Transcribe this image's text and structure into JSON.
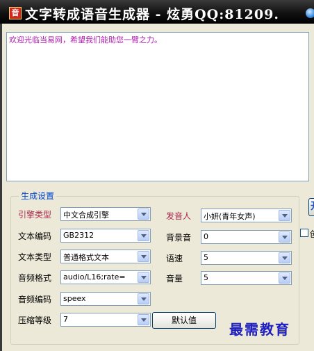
{
  "window": {
    "title": "文字转成语音生成器 - 炫勇QQ:81209.",
    "icon": "app-icon"
  },
  "textarea": {
    "value": "欢迎光临当易网，希望我们能助您一臂之力。"
  },
  "settings": {
    "group_label": "生成设置",
    "engine": {
      "label": "引擎类型",
      "value": "中文合成引擎"
    },
    "encoding": {
      "label": "文本编码",
      "value": "GB2312"
    },
    "text_type": {
      "label": "文本类型",
      "value": "普通格式文本"
    },
    "audio_format": {
      "label": "音频格式",
      "value": "audio/L16;rate="
    },
    "audio_codec": {
      "label": "音频编码",
      "value": "speex"
    },
    "compression": {
      "label": "压缩等级",
      "value": "7"
    },
    "speaker": {
      "label": "发音人",
      "value": "小妍(青年女声)"
    },
    "bg_sound": {
      "label": "背景音",
      "value": "0"
    },
    "speed": {
      "label": "语速",
      "value": "5"
    },
    "volume": {
      "label": "音量",
      "value": "5"
    },
    "default_button": "默认值"
  },
  "side": {
    "button_glyph": "开",
    "checkbox_text": "创"
  },
  "watermark": "最需教育",
  "colors": {
    "titlebar": "#111111",
    "text_magenta": "#b01eb0",
    "group_label": "#0046d5",
    "highlight_label": "#a8264b",
    "watermark": "#2020c0"
  }
}
